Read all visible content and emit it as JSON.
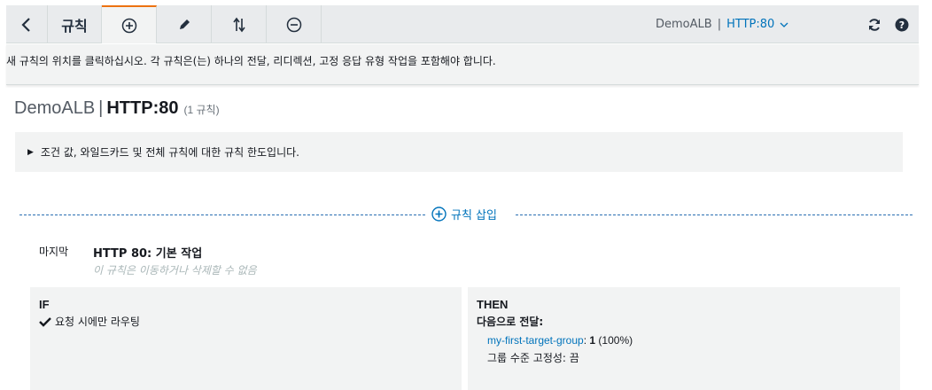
{
  "toolbar": {
    "rules_label": "규칙",
    "listener_lb": "DemoALB",
    "listener_sep": "|",
    "listener_proto": "HTTP:80",
    "icons": [
      "back-arrow-icon",
      "plus-circle-icon",
      "pencil-icon",
      "reorder-arrows-icon",
      "minus-circle-icon",
      "chevron-down-icon",
      "refresh-icon",
      "help-icon"
    ]
  },
  "instruction": "새 규칙의 위치를 클릭하십시오. 각 규칙은(는) 하나의 전달, 리디렉션, 고정 응답 유형 작업을 포함해야 합니다.",
  "header": {
    "lb_name": "DemoALB",
    "sep": "|",
    "listener": "HTTP:80",
    "count": "(1 규칙)"
  },
  "expander_text": "조건 값, 와일드카드 및 전체 규칙에 대한 규칙 한도입니다.",
  "insert_rule_label": "규칙 삽입",
  "rule": {
    "position": "마지막",
    "name": "HTTP 80: 기본 작업",
    "note": "이 규칙은 이동하거나 삭제할 수 없음",
    "if_heading": "IF",
    "condition": "요청 시에만 라우팅",
    "then_heading": "THEN",
    "action_label": "다음으로 전달:",
    "target_group": "my-first-target-group",
    "weight_sep": ":",
    "weight": "1",
    "weight_pct": "(100%)",
    "stickiness": "그룹 수준 고정성: 끔"
  },
  "colors": {
    "accent_orange": "#ec7211",
    "link_blue": "#0073bb",
    "panel_gray": "#f2f3f3"
  }
}
